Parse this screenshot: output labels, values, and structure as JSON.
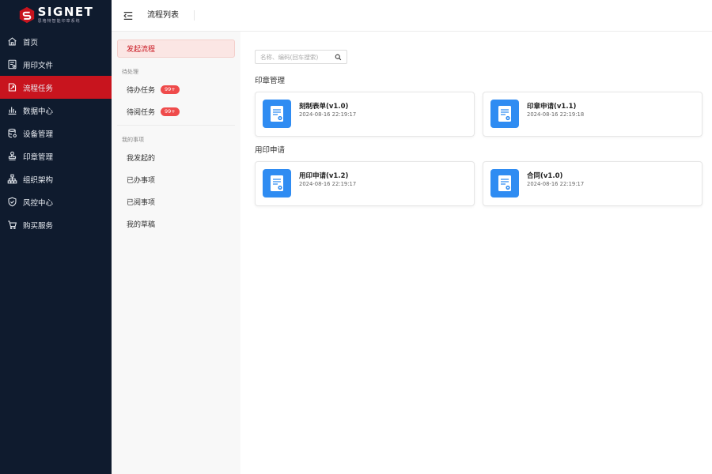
{
  "app": {
    "brand": "SIGNET",
    "brand_sub": "思格特智能印章系统"
  },
  "sidebar": {
    "items": [
      {
        "label": "首页",
        "icon": "home-icon",
        "active": false
      },
      {
        "label": "用印文件",
        "icon": "document-icon",
        "active": false
      },
      {
        "label": "流程任务",
        "icon": "workflow-icon",
        "active": true
      },
      {
        "label": "数据中心",
        "icon": "bar-chart-icon",
        "active": false
      },
      {
        "label": "设备管理",
        "icon": "database-icon",
        "active": false
      },
      {
        "label": "印章管理",
        "icon": "stamp-icon",
        "active": false
      },
      {
        "label": "组织架构",
        "icon": "org-chart-icon",
        "active": false
      },
      {
        "label": "风控中心",
        "icon": "shield-icon",
        "active": false
      },
      {
        "label": "购买服务",
        "icon": "cart-icon",
        "active": false
      }
    ]
  },
  "topbar": {
    "tab": "流程列表"
  },
  "submenu": {
    "active": "发起流程",
    "group_pending": "待处理",
    "todo": {
      "label": "待办任务",
      "badge": "99+"
    },
    "toread": {
      "label": "待阅任务",
      "badge": "99+"
    },
    "group_mine": "我的事项",
    "mine": [
      "我发起的",
      "已办事项",
      "已阅事项",
      "我的草稿"
    ]
  },
  "search": {
    "placeholder": "名称、编码(回车搜索)",
    "value": ""
  },
  "sections": [
    {
      "title": "印章管理",
      "cards": [
        {
          "name": "刻制表单(v1.0)",
          "time": "2024-08-16 22:19:17"
        },
        {
          "name": "印章申请(v1.1)",
          "time": "2024-08-16 22:19:18"
        }
      ]
    },
    {
      "title": "用印申请",
      "cards": [
        {
          "name": "用印申请(v1.2)",
          "time": "2024-08-16 22:19:17"
        },
        {
          "name": "合同(v1.0)",
          "time": "2024-08-16 22:19:17"
        }
      ]
    }
  ],
  "colors": {
    "sidebar_bg": "#0f1b2e",
    "accent_red": "#c8141e",
    "card_icon_blue": "#2f8cf2",
    "badge_red": "#ef4b4b"
  }
}
